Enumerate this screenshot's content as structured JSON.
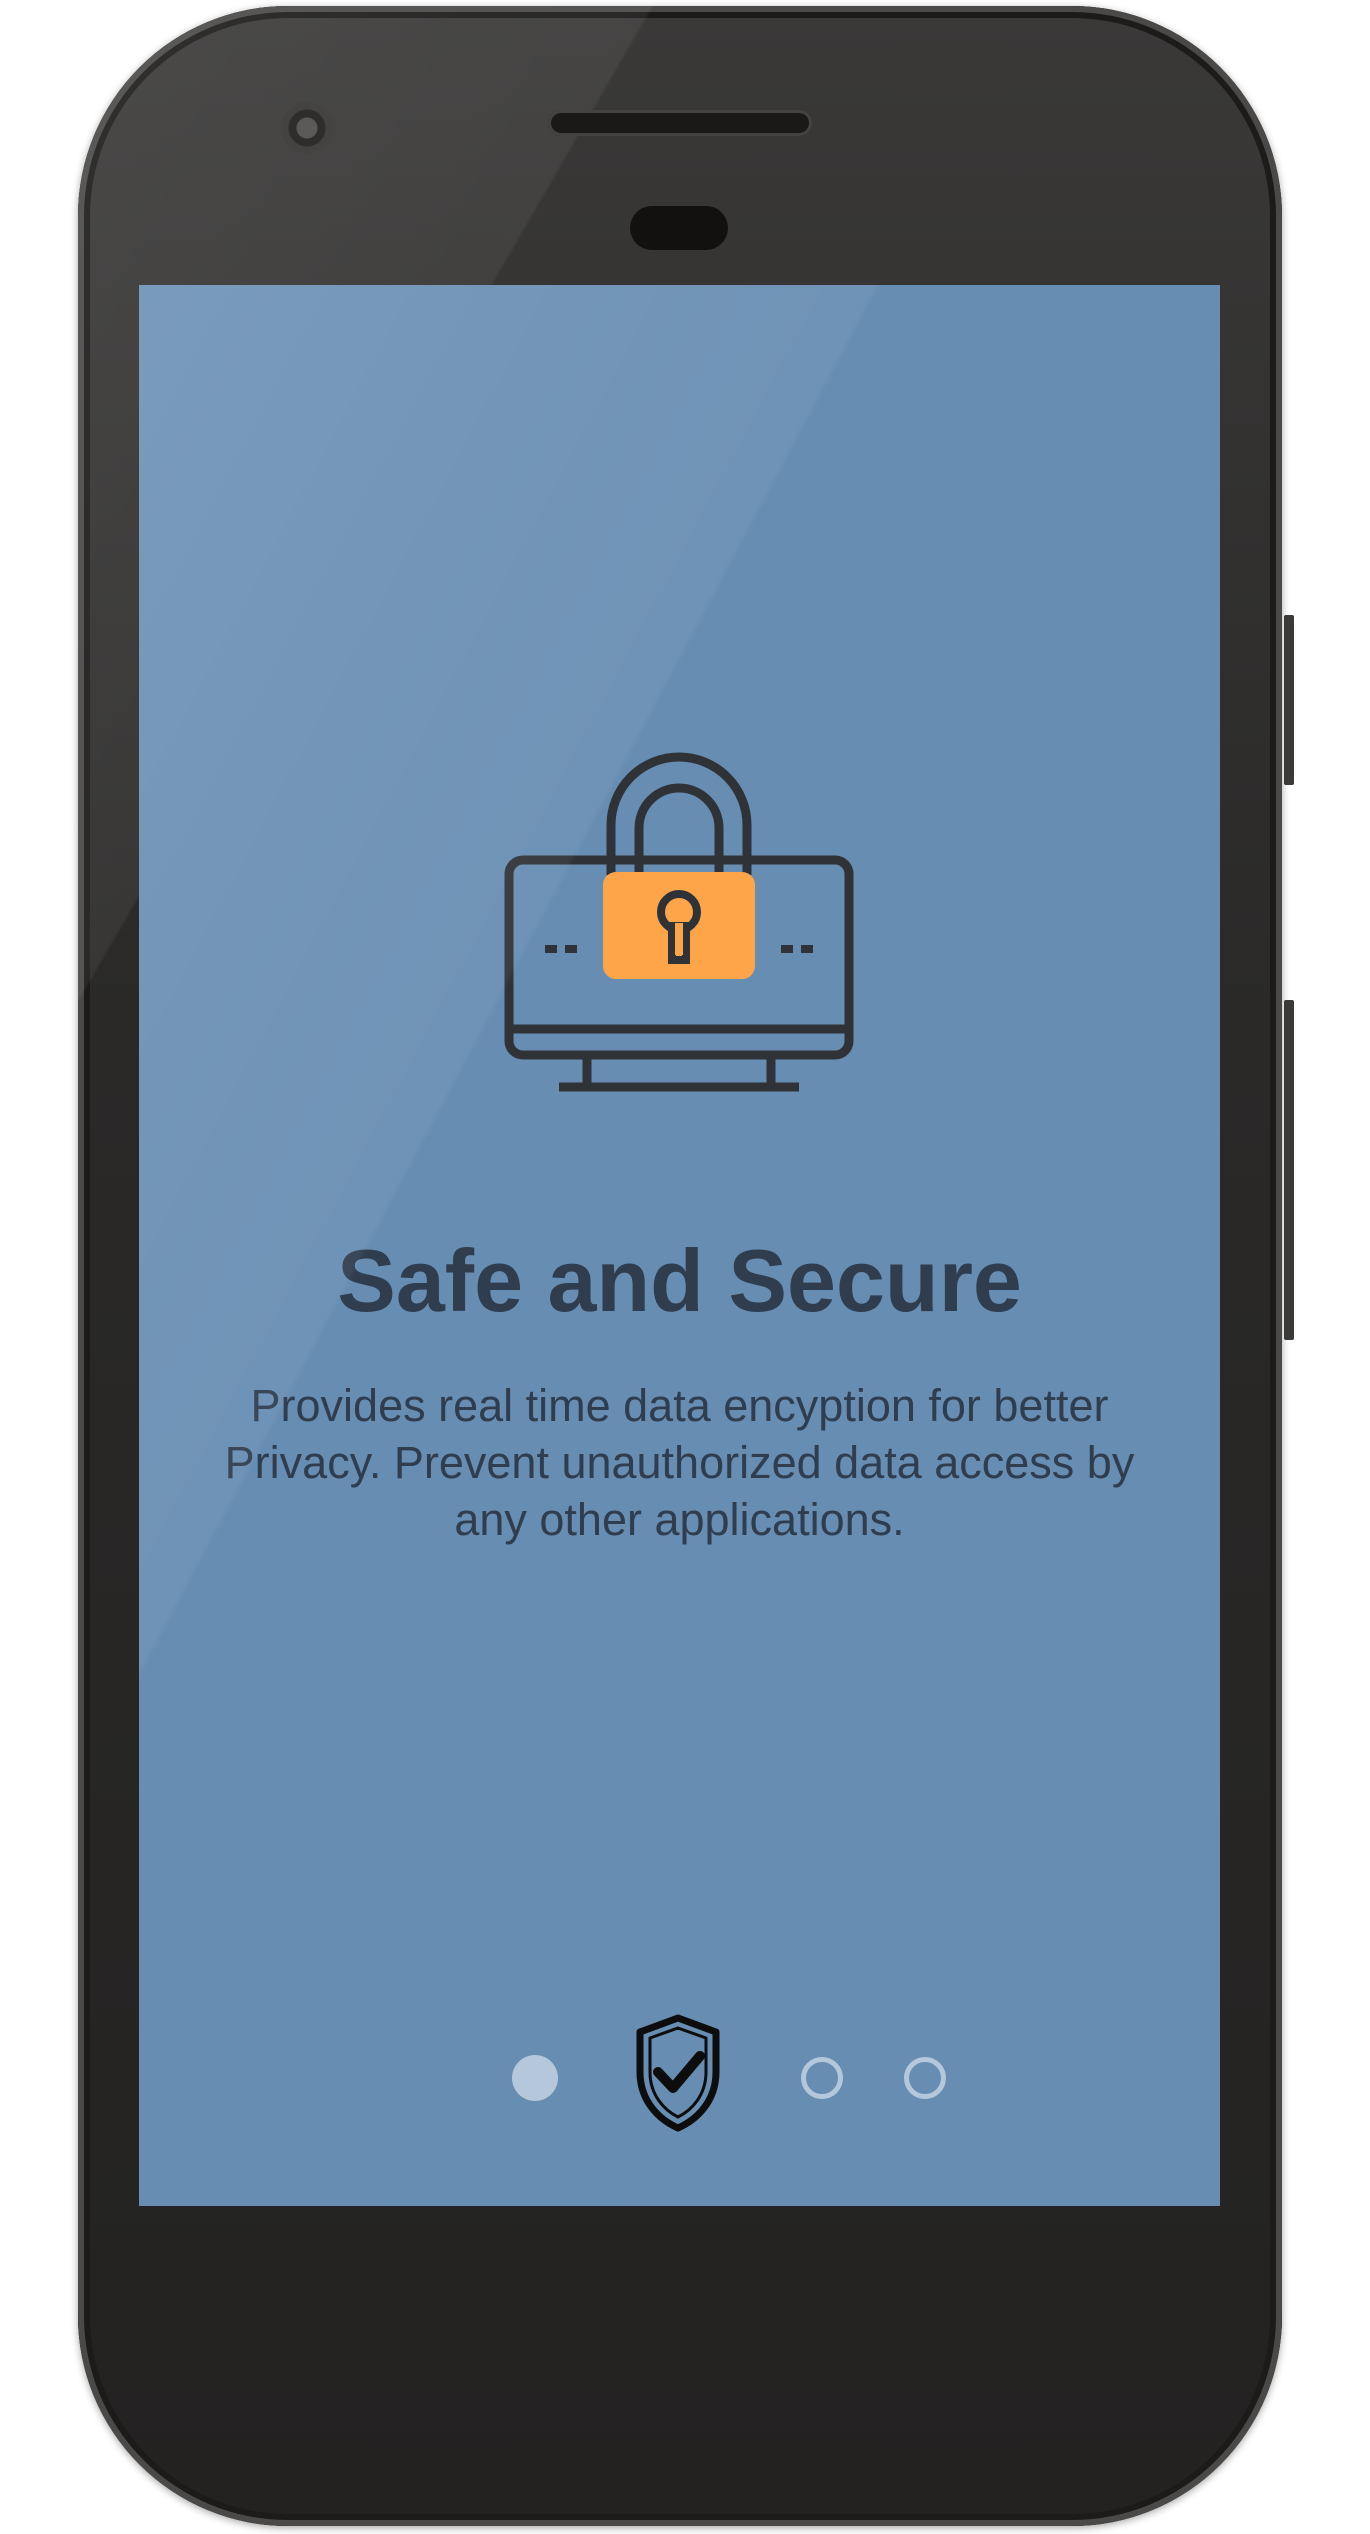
{
  "app": {
    "screen_background": "#678db2",
    "accent_color": "#fea54a"
  },
  "onboarding": {
    "illustration_icon": "lock-on-monitor-icon",
    "title": "Safe and Secure",
    "description": "Provides real time data encyption for better Privacy. Prevent unauthorized data access by any other applications."
  },
  "page_indicator": {
    "total_pages": 4,
    "current_page": 2,
    "current_page_icon": "shield-check-icon"
  }
}
